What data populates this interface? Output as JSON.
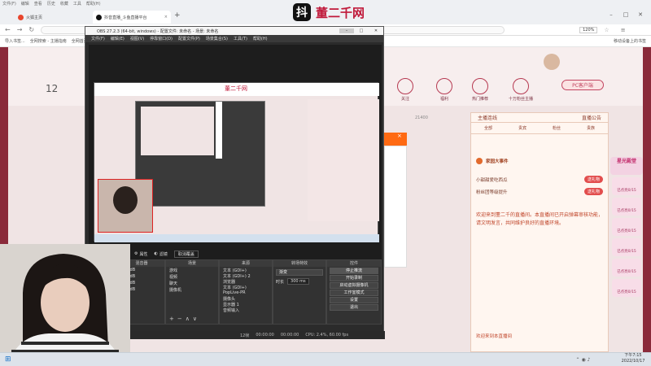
{
  "browser": {
    "menu": [
      "文件(F)",
      "编辑",
      "查看",
      "历史",
      "收藏",
      "工具",
      "帮助(H)"
    ],
    "tabs": [
      {
        "label": "火狐主页"
      },
      {
        "label": "抖音直播_斗鱼直播平台"
      }
    ],
    "new_tab": "+",
    "zoom": "120%",
    "bookmarks": [
      "导入书签...",
      "全网搜索 - 主播指南",
      "全网首页 - 主播...",
      "移动设备上的书签"
    ],
    "brand_logo": "抖",
    "brand_name": "董二千网"
  },
  "page": {
    "badge_number": "12",
    "nav_items": [
      "关注",
      "福利",
      "热门推荐",
      "十万粉丝主播",
      "PC客户端"
    ],
    "pc_button": "PC客户端",
    "user_id": "21400",
    "chat_tabs": [
      "主播连线",
      "直播公告"
    ],
    "chat_subtabs": [
      "全部",
      "贵宾",
      "粉丝",
      "贵族"
    ],
    "chat_rows": [
      {
        "text": "家园大事件",
        "chip": ""
      },
      {
        "text": "小甜甜爱吃西瓜",
        "chip": "送礼物"
      },
      {
        "text": "粉丝团等级提升",
        "chip": "送礼物"
      }
    ],
    "chat_notice": "欢迎来到董二千的直播间。本直播间已开启弹幕审核功能，请文明发言，共同维护良好的直播环境。",
    "chat_bottom": "欢迎来到本直播间",
    "promo_title": "星光殿堂",
    "promo_items": [
      "已点亮0/15",
      "已点亮0/15",
      "已点亮0/15",
      "已点亮0/15",
      "已点亮0/15",
      "已点亮0/15"
    ]
  },
  "obs": {
    "title": "OBS 27.2.3 (64-bit, windows) - 配置文件: 未命名 - 场景: 未命名",
    "menu": [
      "文件(F)",
      "编辑(E)",
      "视图(V)",
      "停靠窗口(D)",
      "配置文件(P)",
      "场景集合(S)",
      "工具(T)",
      "帮助(H)"
    ],
    "toolbar": [
      "属性",
      "滤镜",
      "取消覆盖"
    ],
    "docks": {
      "scenes": {
        "title": "场景",
        "items": [
          "游戏",
          "视频",
          "聊天",
          "摄像机"
        ]
      },
      "sources": {
        "title": "来源",
        "items": [
          "文本 (GDI+)",
          "文本 (GDI+) 2",
          "浏览器",
          "文本 (GDI+)",
          "PopLive-PR",
          "摄像头",
          "显示器 1",
          "音频输入"
        ]
      },
      "mixer": {
        "title": "混音器",
        "values": [
          "0.0 dB",
          "0.0 dB",
          "0.0 dB",
          "0.0 dB"
        ]
      },
      "transitions": {
        "title": "转场特效",
        "mode": "渐变",
        "duration_label": "时长",
        "duration": "300 ms"
      },
      "controls": {
        "title": "控件",
        "buttons": [
          "停止推流",
          "开始录制",
          "启动虚拟摄像机",
          "工作室模式",
          "设置",
          "退出"
        ]
      }
    },
    "status": {
      "frames": "12帧",
      "live": "00:00:00",
      "rec": "00:00:00",
      "cpu": "CPU: 2.4%, 60.00 fps"
    }
  },
  "taskbar": {
    "time": "下午7:15",
    "date": "2022/10/17"
  },
  "colors": {
    "accent": "#c0193a",
    "obs_bg": "#2b2b2b",
    "orange": "#ff6a13"
  }
}
